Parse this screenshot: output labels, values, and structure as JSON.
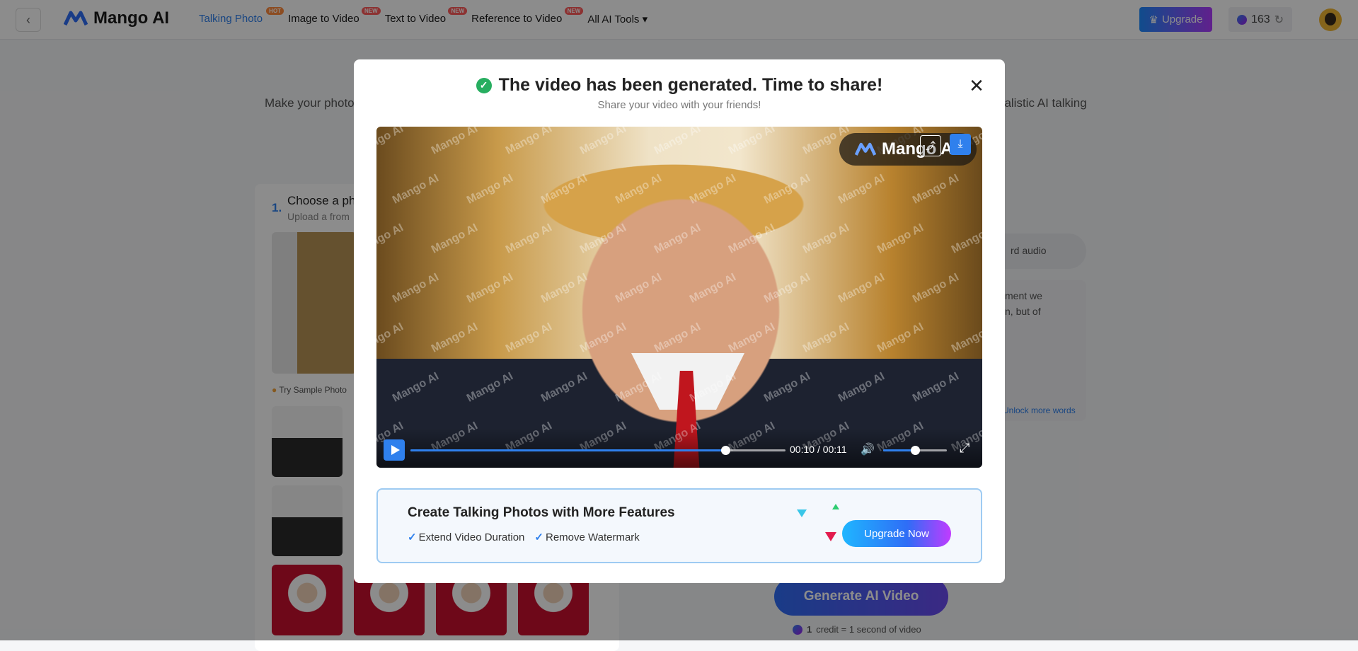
{
  "nav": {
    "logo": "Mango AI",
    "items": [
      {
        "label": "Talking Photo",
        "tag": "HOT"
      },
      {
        "label": "Image to Video",
        "tag": "NEW"
      },
      {
        "label": "Text to Video",
        "tag": "NEW"
      },
      {
        "label": "Reference to Video",
        "tag": "NEW"
      },
      {
        "label": "All AI Tools ▾",
        "tag": ""
      }
    ],
    "upgrade": "Upgrade",
    "credits": "163"
  },
  "page": {
    "hero_left": "Make your photo",
    "hero_right": "ealistic AI talking",
    "step_number": "1.",
    "step_title": "Choose a ph",
    "step_sub": "Upload a from",
    "sample_label": "Try Sample Photo",
    "record_audio": "rd audio",
    "right_text_1": "ment we",
    "right_text_2": "n, but of",
    "unlock": "Unlock more words",
    "generate": "Generate AI Video",
    "credit_bold": "1",
    "credit_rest": "credit = 1 second of video"
  },
  "modal": {
    "title": "The video has been generated. Time to share!",
    "subtitle": "Share your video with your friends!",
    "video": {
      "brand": "Mango AI",
      "watermark": "Mango AI",
      "current_time": "00:10",
      "separator": "/",
      "duration": "00:11",
      "progress": 0.84,
      "volume": 0.5
    },
    "promo": {
      "title": "Create Talking Photos with More Features",
      "feature_1": "Extend Video Duration",
      "feature_2": "Remove Watermark",
      "button": "Upgrade Now"
    }
  }
}
